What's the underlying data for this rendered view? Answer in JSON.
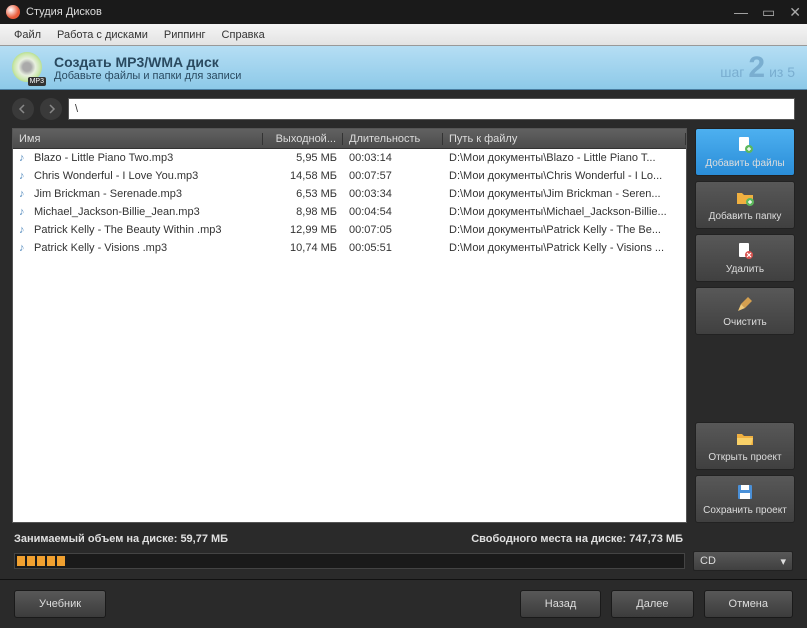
{
  "titlebar": {
    "app_name": "Студия Дисков"
  },
  "menu": [
    "Файл",
    "Работа с дисками",
    "Риппинг",
    "Справка"
  ],
  "header": {
    "title": "Создать MP3/WMA диск",
    "subtitle": "Добавьте файлы и папки для записи",
    "step_word": "шаг",
    "step_num": "2",
    "step_of": "из 5"
  },
  "path": "\\",
  "columns": {
    "name": "Имя",
    "size": "Выходной...",
    "duration": "Длительность",
    "path": "Путь к файлу"
  },
  "files": [
    {
      "name": "Blazo - Little Piano Two.mp3",
      "size": "5,95 МБ",
      "dur": "00:03:14",
      "path": "D:\\Мои документы\\Blazo - Little Piano T..."
    },
    {
      "name": "Chris Wonderful - I Love You.mp3",
      "size": "14,58 МБ",
      "dur": "00:07:57",
      "path": "D:\\Мои документы\\Chris Wonderful - I Lo..."
    },
    {
      "name": "Jim Brickman - Serenade.mp3",
      "size": "6,53 МБ",
      "dur": "00:03:34",
      "path": "D:\\Мои документы\\Jim Brickman - Seren..."
    },
    {
      "name": "Michael_Jackson-Billie_Jean.mp3",
      "size": "8,98 МБ",
      "dur": "00:04:54",
      "path": "D:\\Мои документы\\Michael_Jackson-Billie..."
    },
    {
      "name": "Patrick Kelly - The Beauty Within .mp3",
      "size": "12,99 МБ",
      "dur": "00:07:05",
      "path": "D:\\Мои документы\\Patrick Kelly - The Be..."
    },
    {
      "name": "Patrick Kelly - Visions .mp3",
      "size": "10,74 МБ",
      "dur": "00:05:51",
      "path": "D:\\Мои документы\\Patrick Kelly - Visions ..."
    }
  ],
  "sidebar": {
    "add_files": "Добавить файлы",
    "add_folder": "Добавить папку",
    "delete": "Удалить",
    "clear": "Очистить",
    "open_project": "Открыть проект",
    "save_project": "Сохранить проект"
  },
  "status": {
    "used_label": "Занимаемый объем на диске:",
    "used_value": "59,77 МБ",
    "free_label": "Свободного места на диске:",
    "free_value": "747,73 МБ"
  },
  "drive": "CD",
  "footer": {
    "tutorial": "Учебник",
    "back": "Назад",
    "next": "Далее",
    "cancel": "Отмена"
  }
}
